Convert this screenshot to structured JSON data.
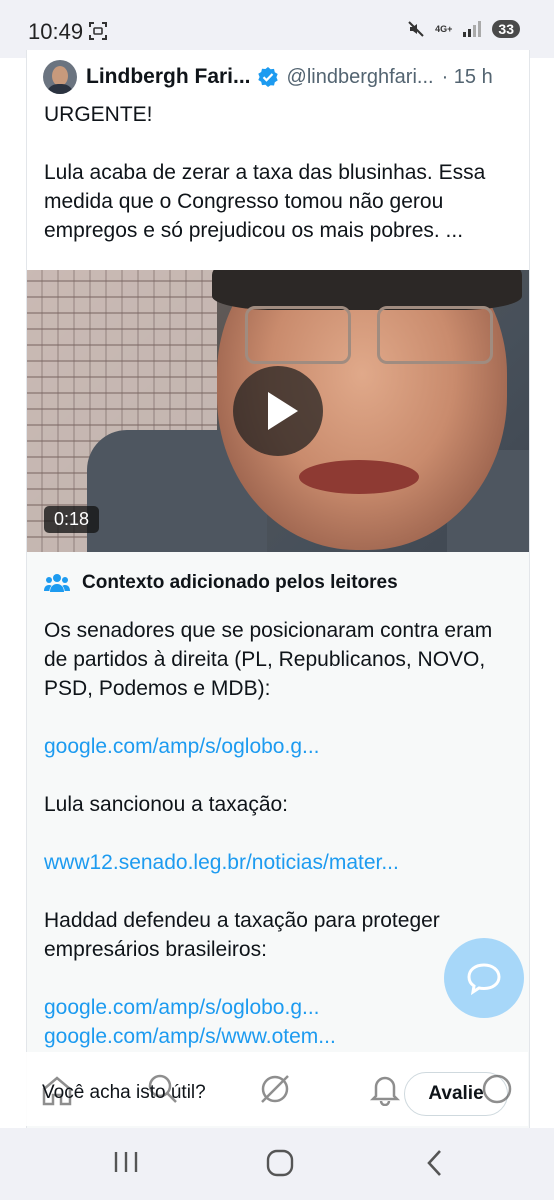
{
  "status_bar": {
    "time": "10:49",
    "network": "4G+",
    "battery": "33"
  },
  "tweet": {
    "author_name": "Lindbergh Fari...",
    "handle": "@lindberghfari...",
    "time_ago": "· 15 h",
    "lines": [
      "URGENTE!",
      "",
      "Lula acaba de zerar a taxa das blusinhas. Essa medida que o Congresso tomou não gerou empregos e só prejudicou os mais pobres. ..."
    ],
    "video_duration": "0:18"
  },
  "community_note": {
    "title": "Contexto adicionado pelos leitores",
    "paragraph1": "Os senadores que se posicionaram contra eram de partidos à direita (PL, Republicanos, NOVO, PSD, Podemos e MDB):",
    "link1": "google.com/amp/s/oglobo.g...",
    "paragraph2": "Lula sancionou a taxação:",
    "link2": "www12.senado.leg.br/noticias/mater...",
    "paragraph3": "Haddad defendeu a taxação para proteger empresários brasileiros:",
    "link3": "google.com/amp/s/oglobo.g...",
    "link4": "google.com/amp/s/www.otem..."
  },
  "helpful_bar": {
    "question": "Você acha isto útil?",
    "rate_label": "Avalie"
  },
  "colors": {
    "link": "#1d9bf0",
    "verified": "#1d9bf0",
    "fab": "#a7d7f9"
  },
  "icons": [
    "scan-icon",
    "mute-icon",
    "signal-icon",
    "verified-icon",
    "play-icon",
    "people-icon",
    "home-icon",
    "search-icon",
    "grok-icon",
    "bell-icon",
    "messages-icon",
    "compose-icon",
    "recents-icon",
    "home-nav-icon",
    "back-icon"
  ]
}
